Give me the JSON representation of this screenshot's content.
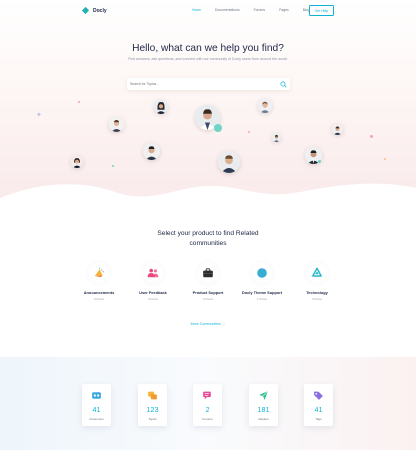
{
  "nav": {
    "logo_text": "Docly",
    "links": [
      "Home",
      "Documentations",
      "Forums",
      "Pages",
      "Blog"
    ],
    "button_label": "Get Help"
  },
  "hero": {
    "title": "Hello, what can we help you find?",
    "subtitle": "Find answers, ask questions, and connect with our community of Docly users from around the world.",
    "search_placeholder": "Search for Topics..."
  },
  "categories": {
    "title": "Select your product to find Related communities",
    "items": [
      {
        "name": "Announcements",
        "count": "0 Posts",
        "icon": "megaphone-icon"
      },
      {
        "name": "User Feedback",
        "count": "0 Posts",
        "icon": "users-icon"
      },
      {
        "name": "Product Support",
        "count": "2 Posts",
        "icon": "briefcase-icon"
      },
      {
        "name": "Docly Theme Support",
        "count": "1 Posts",
        "icon": "globe-icon"
      },
      {
        "name": "Technology",
        "count": "0 Posts",
        "icon": "recycle-icon"
      }
    ],
    "more_link": "More Communities →"
  },
  "stats": [
    {
      "value": "41",
      "label": "Customers",
      "icon": "customers-icon"
    },
    {
      "value": "123",
      "label": "Topics",
      "icon": "topics-icon"
    },
    {
      "value": "2",
      "label": "Forums",
      "icon": "forums-icon"
    },
    {
      "value": "181",
      "label": "Replies",
      "icon": "replies-icon"
    },
    {
      "value": "41",
      "label": "Tags",
      "icon": "tags-icon"
    }
  ],
  "colors": {
    "accent": "#10b3d6",
    "heading": "#1d2746",
    "muted": "#9aa1b1"
  }
}
